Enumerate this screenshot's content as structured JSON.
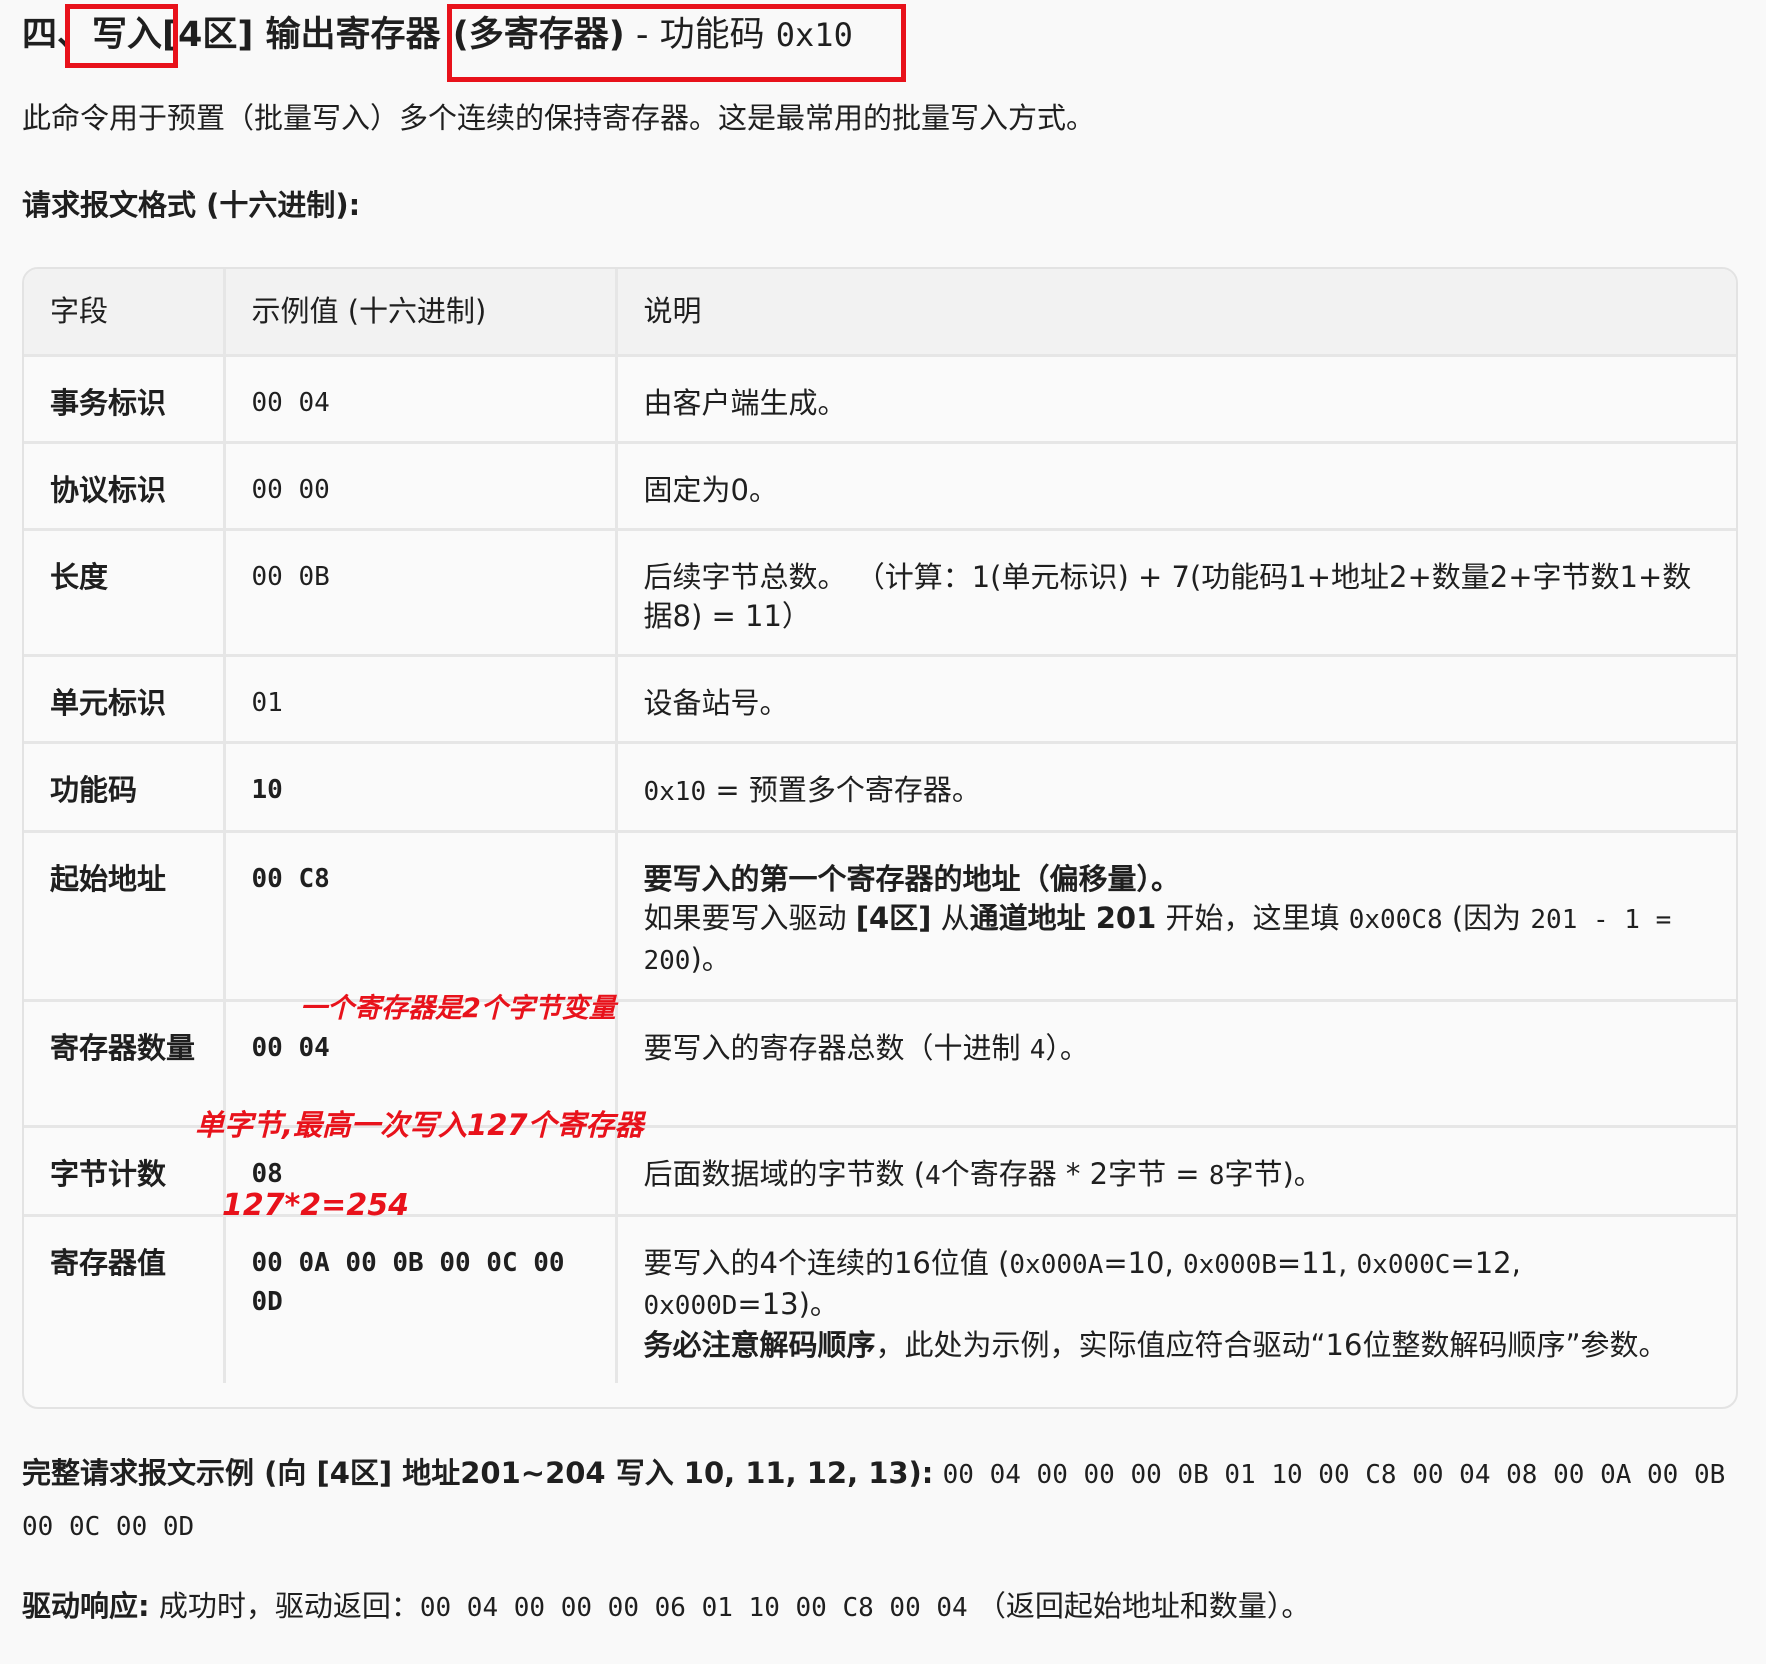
{
  "title": {
    "prefix": "四、",
    "write": "写入",
    "middle": "[4区] 输出寄存器",
    "multi": "(多寄存器)",
    "dash": " - 功能码 ",
    "code": "0x10"
  },
  "intro": "此命令用于预置（批量写入）多个连续的保持寄存器。这是最常用的批量写入方式。",
  "request_heading": "请求报文格式 (十六进制):",
  "table": {
    "headers": [
      "字段",
      "示例值 (十六进制)",
      "说明"
    ],
    "rows": [
      {
        "field": "事务标识",
        "value": "00 04",
        "desc": "由客户端生成。"
      },
      {
        "field": "协议标识",
        "value": "00 00",
        "desc": "固定为0。"
      },
      {
        "field": "长度",
        "value": "00 0B",
        "desc": "后续字节总数。 （计算：1(单元标识) + 7(功能码1+地址2+数量2+字节数1+数据8) = 11）"
      },
      {
        "field": "单元标识",
        "value": "01",
        "desc": "设备站号。"
      },
      {
        "field": "功能码",
        "value": "10",
        "desc_code": "0x10",
        "desc": " = 预置多个寄存器。"
      },
      {
        "field": "起始地址",
        "value": "00 C8",
        "desc_bold": "要写入的第一个寄存器的地址（偏移量）。",
        "desc_l2_a": "如果要写入驱动 ",
        "desc_l2_b": "[4区]",
        "desc_l2_c": " 从",
        "desc_l2_d": "通道地址 201",
        "desc_l2_e": " 开始，这里填 ",
        "desc_l2_code": "0x00C8",
        "desc_l2_f": " (因为 ",
        "desc_l2_calc": "201 - 1 = 200",
        "desc_l2_g": ")。"
      },
      {
        "field": "寄存器数量",
        "value": "00 04",
        "desc_a": "要写入的寄存器总数（十进制 ",
        "desc_code": "4",
        "desc_b": "）。"
      },
      {
        "field": "字节计数",
        "value": "08",
        "desc_a": "后面数据域的字节数 (",
        "desc_code1": "4",
        "desc_b": "个寄存器 * 2字节 = ",
        "desc_code2": "8",
        "desc_c": "字节)。"
      },
      {
        "field": "寄存器值",
        "value": "00 0A 00 0B 00 0C 00 0D",
        "desc_a": "要写入的4个连续的16位值 (",
        "c1": "0x000A",
        "d1": "=10, ",
        "c2": "0x000B",
        "d2": "=11, ",
        "c3": "0x000C",
        "d3": "=12, ",
        "c4": "0x000D",
        "d4": "=13)。",
        "desc_bold": "务必注意解码顺序",
        "desc_rest": "，此处为示例，实际值应符合驱动“16位整数解码顺序”参数。"
      }
    ]
  },
  "annotations": {
    "a1": "一个寄存器是2个字节变量",
    "a2": "单字节,最高一次写入127个寄存器",
    "a3": "127*2=254"
  },
  "example": {
    "label": "完整请求报文示例 (向 [4区] 地址201~204 写入 10, 11, 12, 13):",
    "bytes": "00 04 00 00 00 0B 01 10 00 C8 00 04 08 00 0A 00 0B 00 0C 00 0D"
  },
  "response": {
    "label": "驱动响应:",
    "text_a": " 成功时，驱动返回：",
    "bytes": "00 04 00 00 00 06 01 10 00 C8 00 04",
    "text_b": " （返回起始地址和数量）。"
  },
  "colors": {
    "annotation_red": "#e8121b",
    "header_bg": "#f2f2f2",
    "border": "#e6e6e6"
  }
}
